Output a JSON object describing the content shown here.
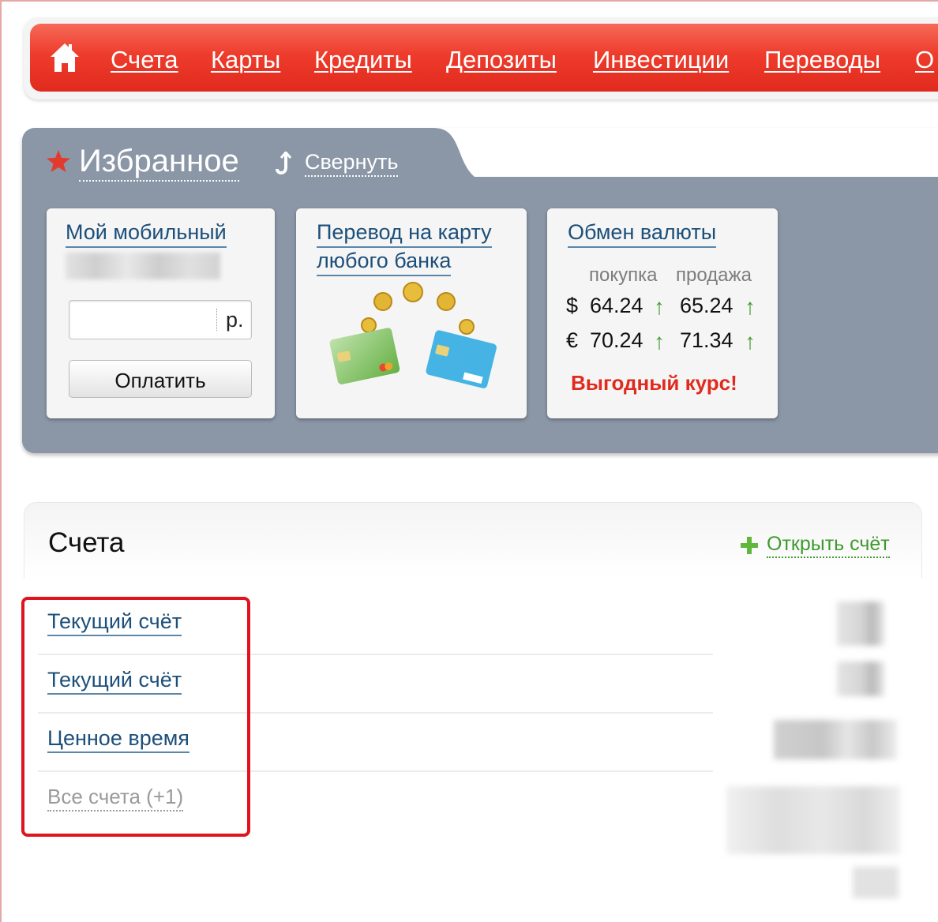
{
  "nav": {
    "home_icon": "home-icon",
    "items": [
      {
        "label": "Счета"
      },
      {
        "label": "Карты"
      },
      {
        "label": "Кредиты"
      },
      {
        "label": "Депозиты"
      },
      {
        "label": "Инвестиции"
      },
      {
        "label": "Переводы"
      },
      {
        "label": "О"
      }
    ]
  },
  "favorites": {
    "title": "Избранное",
    "collapse_label": "Свернуть",
    "mobile": {
      "title": "Мой мобильный",
      "amount_value": "",
      "currency_suffix": "р.",
      "pay_label": "Оплатить"
    },
    "transfer": {
      "title_line1": "Перевод на карту",
      "title_line2": "любого банка"
    },
    "exchange": {
      "title": "Обмен валюты",
      "buy_header": "покупка",
      "sell_header": "продажа",
      "rows": [
        {
          "symbol": "$",
          "buy": "64.24",
          "sell": "65.24"
        },
        {
          "symbol": "€",
          "buy": "70.24",
          "sell": "71.34"
        }
      ],
      "arrow_glyph": "↑",
      "promo": "Выгодный курс!"
    }
  },
  "accounts": {
    "title": "Счета",
    "open_label": "Открыть счёт",
    "items": [
      {
        "label": "Текущий счёт"
      },
      {
        "label": "Текущий счёт"
      },
      {
        "label": "Ценное время"
      }
    ],
    "all_label": "Все счета (+1)"
  },
  "colors": {
    "nav_red": "#e02a1d",
    "panel_gray": "#8b97a6",
    "link_blue": "#1c4f7a",
    "accent_green": "#3f9a2e",
    "highlight_red": "#e0141e"
  }
}
